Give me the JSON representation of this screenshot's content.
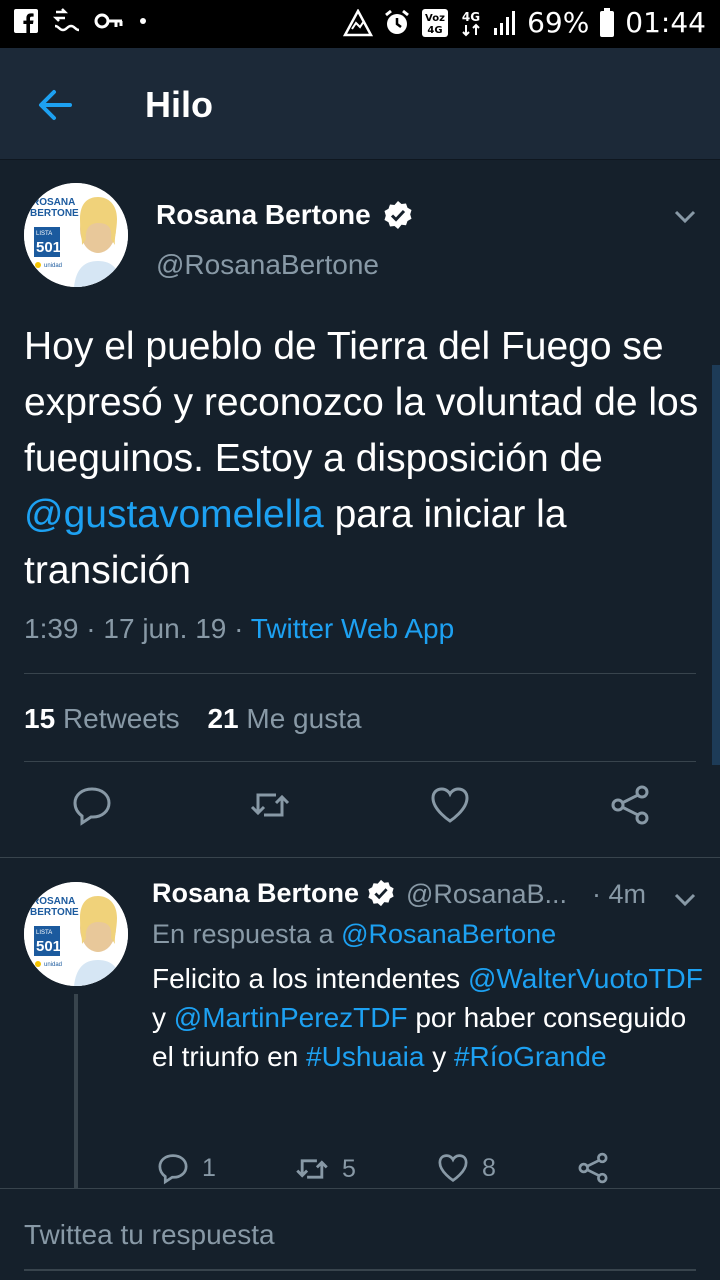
{
  "status_bar": {
    "battery": "69%",
    "time": "01:44",
    "network": "4G",
    "volte": "Voz\n4G"
  },
  "header": {
    "title": "Hilo"
  },
  "main_tweet": {
    "avatar_text": {
      "line1": "ROSANA",
      "line2": "BERTONE",
      "lista": "LISTA",
      "number": "501",
      "party": "unidad"
    },
    "author_name": "Rosana Bertone",
    "handle": "@RosanaBertone",
    "text_part1": "Hoy el pueblo de Tierra del Fuego se expresó y reconozco la voluntad de los fueguinos. Estoy a disposición de ",
    "mention": "@gustavomelella",
    "text_part2": " para iniciar la transición",
    "time": "1:39",
    "dot1": " · ",
    "date": "17 jun. 19",
    "dot2": " · ",
    "source": "Twitter Web App",
    "retweets_count": "15",
    "retweets_label": "Retweets",
    "likes_count": "21",
    "likes_label": "Me gusta"
  },
  "reply_tweet": {
    "author_name": "Rosana Bertone",
    "handle": "@RosanaB...",
    "time_ago": "· 4m",
    "reply_prefix": "En respuesta a ",
    "reply_to": "@RosanaBertone",
    "text_a": "Felicito a los intendentes ",
    "mention1": "@WalterVuotoTDF",
    "text_b": " y ",
    "mention2": "@MartinPerezTDF",
    "text_c": " por haber conseguido el triunfo en ",
    "hashtag1": "#Ushuaia",
    "text_d": " y ",
    "hashtag2": "#RíoGrande",
    "reply_count": "1",
    "retweet_count": "5",
    "like_count": "8"
  },
  "compose": {
    "placeholder": "Twittea tu respuesta"
  },
  "colors": {
    "background": "#15202b",
    "header": "#1c2938",
    "accent": "#1da1f2",
    "secondary_text": "#8899a6",
    "divider": "#38444d"
  },
  "icons": {
    "back": "arrow-left-icon",
    "verified": "verified-badge-icon",
    "more": "chevron-down-icon",
    "reply": "reply-icon",
    "retweet": "retweet-icon",
    "like": "heart-icon",
    "share": "share-icon"
  }
}
